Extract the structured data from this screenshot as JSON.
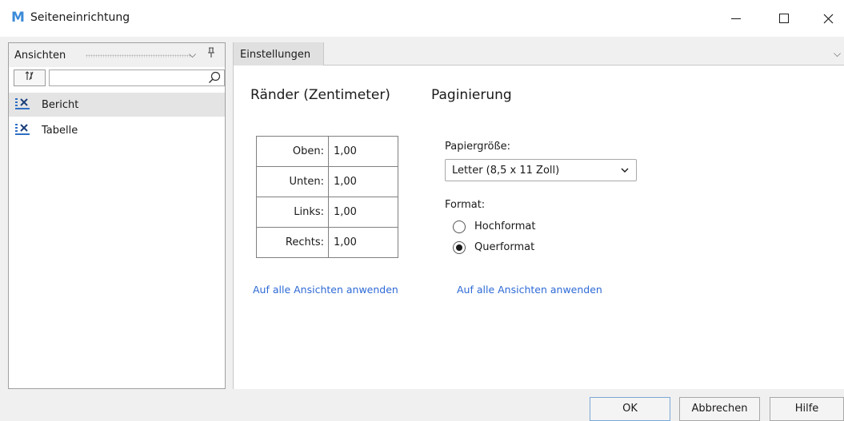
{
  "window": {
    "icon_letter": "M",
    "title": "Seiteneinrichtung"
  },
  "left_panel": {
    "header_title": "Ansichten",
    "sort_button_label": "1̸",
    "search_placeholder": "",
    "items": [
      {
        "label": "Bericht",
        "selected": true
      },
      {
        "label": "Tabelle",
        "selected": false
      }
    ]
  },
  "tabs": [
    {
      "label": "Einstellungen",
      "active": true
    }
  ],
  "margins": {
    "title": "Ränder (Zentimeter)",
    "rows": [
      {
        "label": "Oben:",
        "value": "1,00"
      },
      {
        "label": "Unten:",
        "value": "1,00"
      },
      {
        "label": "Links:",
        "value": "1,00"
      },
      {
        "label": "Rechts:",
        "value": "1,00"
      }
    ],
    "apply_link": "Auf alle Ansichten anwenden"
  },
  "pagination": {
    "title": "Paginierung",
    "paper_size_label": "Papiergröße:",
    "paper_size_value": "Letter (8,5 x 11 Zoll)",
    "format_label": "Format:",
    "orientation_options": [
      {
        "label": "Hochformat",
        "checked": false
      },
      {
        "label": "Querformat",
        "checked": true
      }
    ],
    "apply_link": "Auf alle Ansichten anwenden"
  },
  "footer": {
    "ok_label": "OK",
    "cancel_label": "Abbrechen",
    "help_label": "Hilfe"
  },
  "colors": {
    "accent_link": "#2e6ad6",
    "app_icon": "#3c8bd9",
    "panel_bg": "#f0f0f0"
  }
}
